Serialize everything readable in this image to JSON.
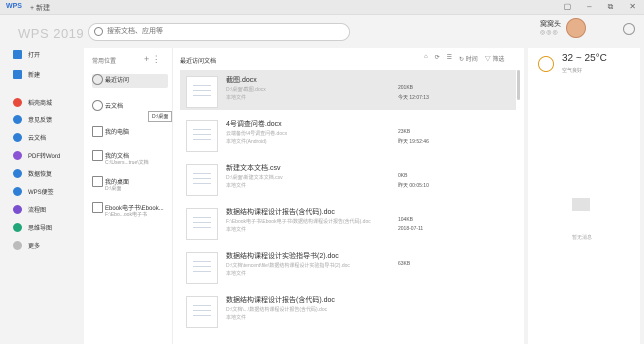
{
  "titlebar": {
    "logo": "WPS",
    "new_tab": "+ 新建",
    "controls": [
      "▢",
      "–",
      "⧉",
      "✕"
    ]
  },
  "app_title": "WPS 2019",
  "search": {
    "placeholder": "搜索文档、应用等"
  },
  "user": {
    "name": "窝窝头",
    "status_dots": "◎◎◎"
  },
  "sidebar": {
    "items": [
      {
        "label": "打开",
        "icon": "folder-icon",
        "color": "#2f7fd6"
      },
      {
        "label": "新建",
        "icon": "new-icon",
        "color": "#2f7fd6"
      },
      {
        "label": "稻壳商城",
        "icon": "store-icon",
        "color": "#e84a3b"
      },
      {
        "label": "意见反馈",
        "icon": "feedback-icon",
        "color": "#2f7fd6"
      },
      {
        "label": "云文档",
        "icon": "cloud-icon",
        "color": "#2f7fd6"
      },
      {
        "label": "PDF转Word",
        "icon": "pdf-icon",
        "color": "#8b54d4"
      },
      {
        "label": "数据恢复",
        "icon": "recovery-icon",
        "color": "#2f7fd6"
      },
      {
        "label": "WPS便签",
        "icon": "note-icon",
        "color": "#2f7fd6"
      },
      {
        "label": "流程图",
        "icon": "flowchart-icon",
        "color": "#7a4fd0"
      },
      {
        "label": "思维导图",
        "icon": "mindmap-icon",
        "color": "#21a67a"
      },
      {
        "label": "更多",
        "icon": "more-icon",
        "color": "#999999"
      }
    ]
  },
  "locations": {
    "header": "常用位置",
    "actions": "+ ⋮",
    "items": [
      {
        "label": "最近访问",
        "sub": "",
        "icon": "clock-icon"
      },
      {
        "label": "云文档",
        "sub": "",
        "icon": "cloud-icon"
      },
      {
        "label": "我的电脑",
        "sub": "",
        "icon": "computer-icon"
      },
      {
        "label": "我的文档",
        "sub": "C:\\Users...true\\文档",
        "icon": "doc-folder-icon"
      },
      {
        "label": "我的桌面",
        "sub": "D:\\桌面",
        "icon": "desktop-icon"
      },
      {
        "label": "Ebook电子书\\Ebook...",
        "sub": "F:\\Ebo...ook电子书",
        "icon": "ebook-icon"
      }
    ]
  },
  "files_header": "最近访问文档",
  "toolbar": {
    "items": [
      "⌂",
      "⟳",
      "☰",
      "↻ 时间",
      "▽ 筛选"
    ]
  },
  "files": [
    {
      "name": "截图.docx",
      "path": "D:\\桌面\\截图.docx",
      "source": "本地文件",
      "size": "201KB",
      "time": "今天 12:07:13"
    },
    {
      "name": "4号调查问卷.docx",
      "path": "云端备份\\4号调查问卷.docx",
      "source": "本地文件(Android)",
      "size": "23KB",
      "time": "昨天 19:52:46"
    },
    {
      "name": "新建文本文档.csv",
      "path": "D:\\桌面\\新建文本文档.csv",
      "source": "本地文件",
      "size": "0KB",
      "time": "昨天 00:05:10"
    },
    {
      "name": "数据结构课程设计报告(含代码).doc",
      "path": "F:\\Ebook电子书\\Ebook电子书\\数据结构课程设计报告(含代码).doc",
      "source": "本地文件",
      "size": "104KB",
      "time": "2018-07-11"
    },
    {
      "name": "数据结构课程设计实验指导书(2).doc",
      "path": "D:\\文档\\tencent\\file\\数据结构课程设计实验指导书(2).doc",
      "source": "本地文件",
      "size": "63KB",
      "time": ""
    },
    {
      "name": "数据结构课程设计报告(含代码).doc",
      "path": "D:\\文档\\...\\数据结构课程设计报告(含代码).doc",
      "source": "本地文件",
      "size": "",
      "time": ""
    }
  ],
  "tooltip": "D:\\桌面",
  "weather": {
    "temp": "32 ~ 25°C",
    "air": "空气良好"
  },
  "messages_empty": "暂无消息"
}
